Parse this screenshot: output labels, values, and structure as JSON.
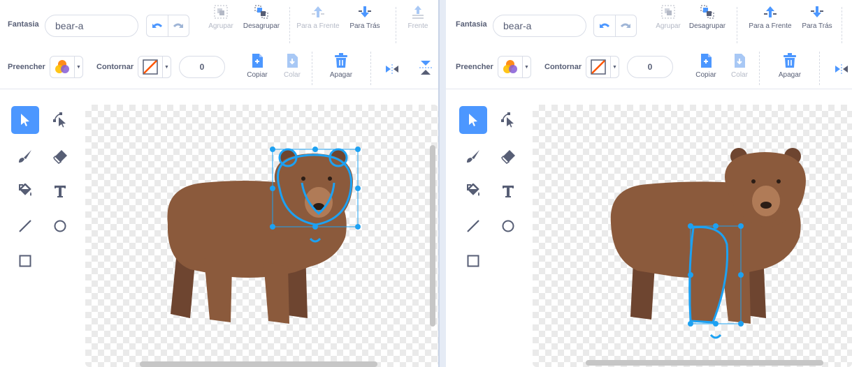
{
  "colors": {
    "accent": "#4c97ff",
    "bear": "#8b5a3c",
    "bear_dark": "#6e4530",
    "selection": "#1da1f2"
  },
  "left": {
    "costume_label": "Fantasia",
    "costume_name": "bear-a",
    "group_label": "Agrupar",
    "ungroup_label": "Desagrupar",
    "forward_label": "Para a Frente",
    "backward_label": "Para Trás",
    "front_label": "Frente",
    "fill_label": "Preencher",
    "outline_label": "Contornar",
    "outline_width": "0",
    "copy_label": "Copiar",
    "paste_label": "Colar",
    "delete_label": "Apagar"
  },
  "right": {
    "costume_label": "Fantasia",
    "costume_name": "bear-a",
    "group_label": "Agrupar",
    "ungroup_label": "Desagrupar",
    "forward_label": "Para a Frente",
    "backward_label": "Para Trás",
    "fill_label": "Preencher",
    "outline_label": "Contornar",
    "outline_width": "0",
    "copy_label": "Copiar",
    "paste_label": "Colar",
    "delete_label": "Apagar"
  },
  "tools": [
    "select-icon",
    "reshape-icon",
    "brush-icon",
    "eraser-icon",
    "fill-icon",
    "text-icon",
    "line-icon",
    "circle-icon",
    "rectangle-icon"
  ]
}
